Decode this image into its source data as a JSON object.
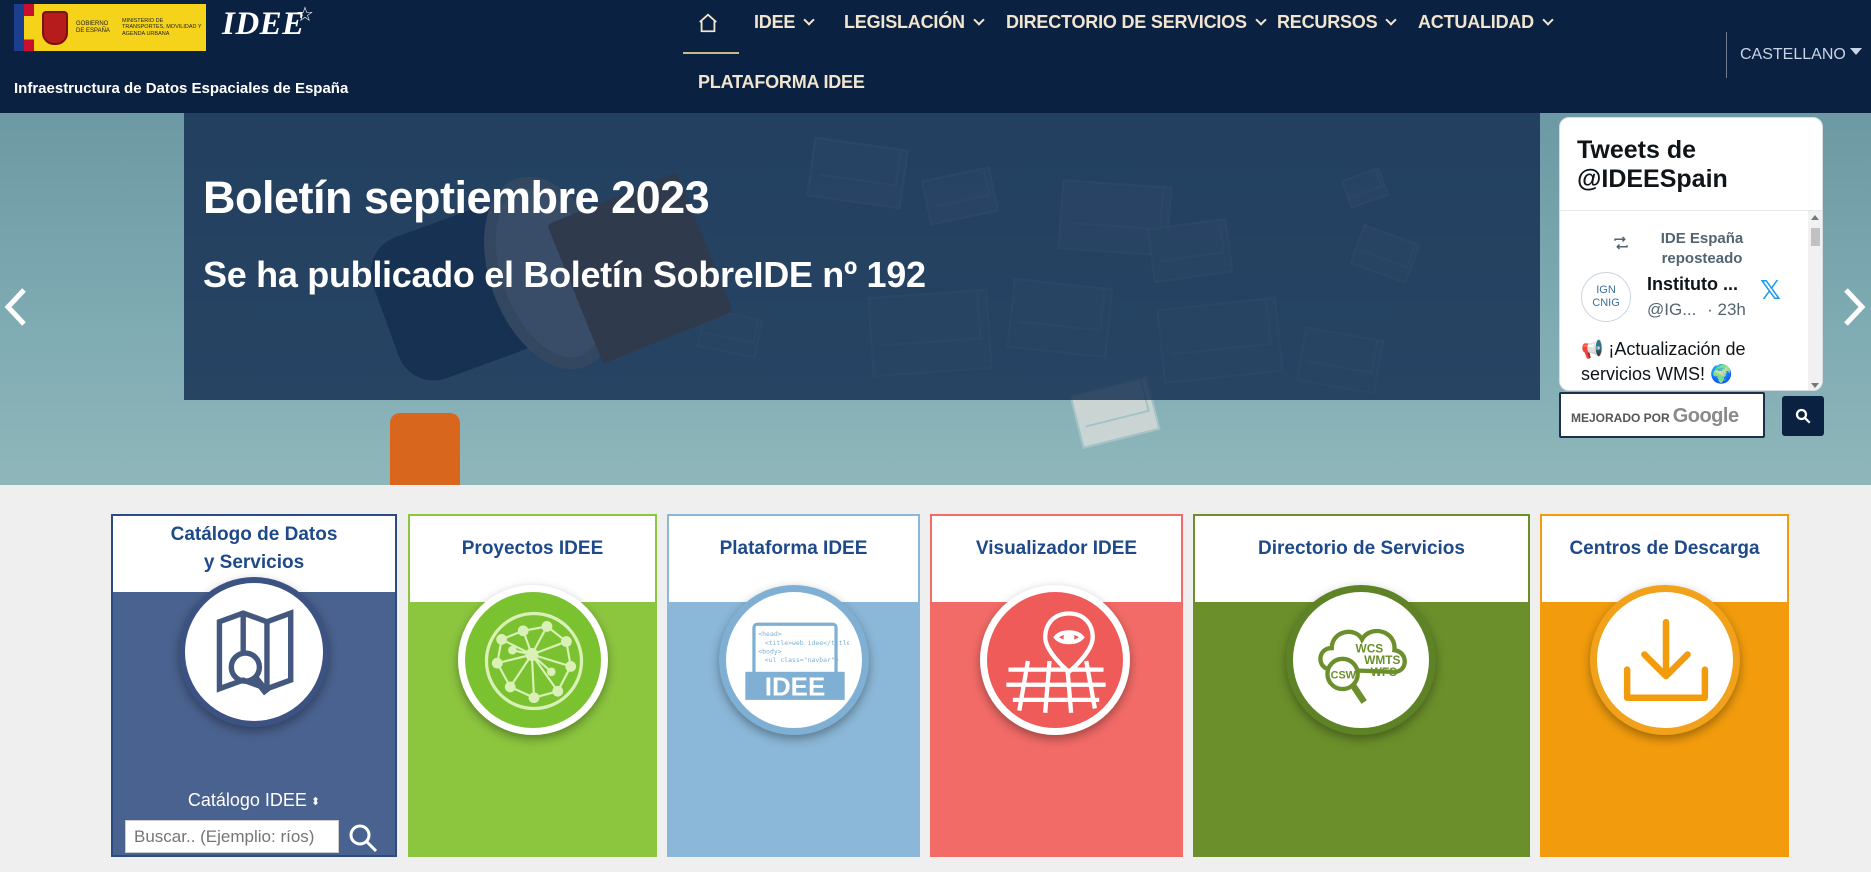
{
  "header": {
    "gov_text_1": "Gobierno de España",
    "gov_text_2": "Ministerio de Transportes, Movilidad y Agenda Urbana",
    "idee_logo": "IDEE",
    "site_title": "Infraestructura de Datos Espaciales de España",
    "nav": [
      {
        "label": "IDEE"
      },
      {
        "label": "LEGISLACIÓN"
      },
      {
        "label": "DIRECTORIO DE SERVICIOS"
      },
      {
        "label": "RECURSOS"
      },
      {
        "label": "ACTUALIDAD"
      }
    ],
    "nav_platform": "PLATAFORMA IDEE",
    "language": "CASTELLANO"
  },
  "banner": {
    "title": "Boletín septiembre 2023",
    "subtitle": "Se ha publicado el Boletín SobreIDE nº 192"
  },
  "tweets": {
    "title": "Tweets de @IDEESpain",
    "retweet_label": "IDE España reposteado",
    "avatar_text": "IGN CNIG",
    "author_name": "Instituto ...",
    "author_handle": "@IG...",
    "time": "· 23h",
    "x_logo": "𝕏",
    "text": "📢 ¡Actualización de servicios WMS! 🌍"
  },
  "google_search": {
    "label": "MEJORADO POR",
    "brand": "Google"
  },
  "cards": [
    {
      "title_line1": "Catálogo de Datos",
      "title_line2": "y Servicios",
      "catalog_label": "Catálogo IDEE",
      "sort_icon": "⬍",
      "search_placeholder": "Buscar.. (Ejemplio: ríos)"
    },
    {
      "title": "Proyectos IDEE"
    },
    {
      "title": "Plataforma IDEE"
    },
    {
      "title": "Visualizador IDEE"
    },
    {
      "title": "Directorio de Servicios"
    },
    {
      "title": "Centros de Descarga"
    }
  ],
  "plataforma_icon": {
    "code_lines": [
      "<head>",
      "<title>web idee</title>",
      "<body>",
      "<ul class=\"navbar\">"
    ],
    "word": "IDEE"
  },
  "directorio_icon": {
    "labels": [
      "WCS",
      "WMTS",
      "WFS",
      "CSW"
    ]
  },
  "colors": {
    "header_bg": "#0b2141",
    "nav_text": "#f1e5cf",
    "card_title": "#1f4a8a",
    "catalogo": "#4a628f",
    "proyectos": "#8cc63f",
    "plataforma": "#8bb8d8",
    "visualizador": "#f26b67",
    "directorio": "#6b8f2b",
    "descarga": "#f29c0d"
  },
  "icons": [
    "home-icon",
    "chevron-down-icon",
    "caret-down-icon",
    "chevron-left-icon",
    "chevron-right-icon",
    "retweet-icon",
    "x-logo-icon",
    "search-icon",
    "map-search-icon",
    "network-icon",
    "code-screen-icon",
    "map-pin-eye-icon",
    "cloud-services-icon",
    "download-icon"
  ]
}
